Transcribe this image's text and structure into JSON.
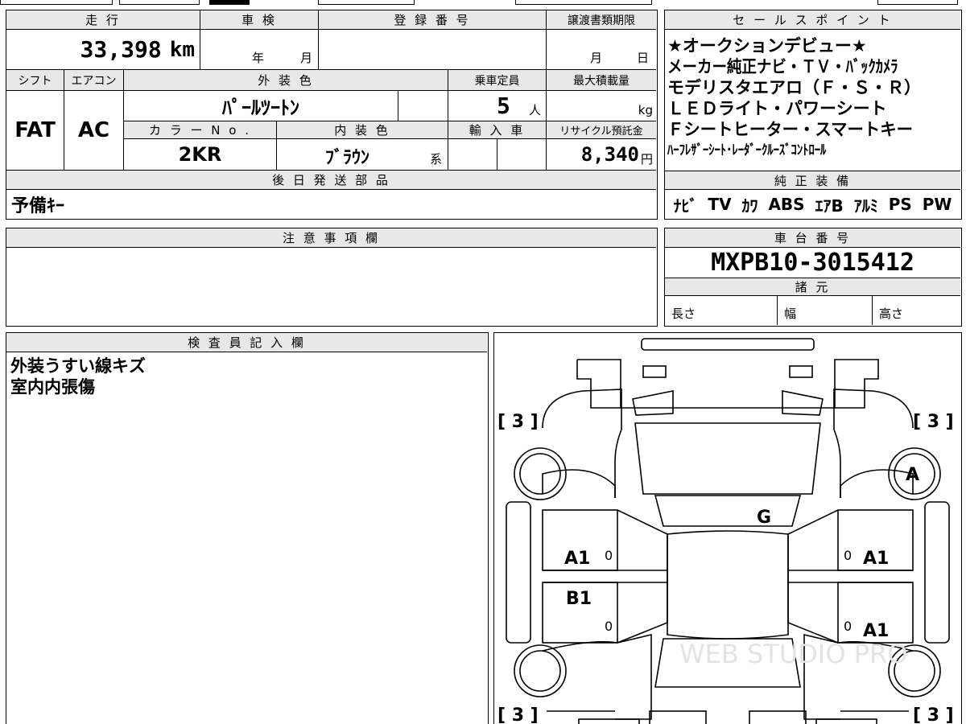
{
  "top": {
    "mileage_label": "走 行",
    "mileage_value": "33,398",
    "mileage_unit": "km",
    "shaken_label": "車 検",
    "shaken_year": "年",
    "shaken_month": "月",
    "registration_label": "登 録 番 号",
    "transfer_label": "譲渡書類期限",
    "transfer_month": "月",
    "transfer_day": "日"
  },
  "spec": {
    "shift_label": "シフト",
    "shift_value": "FAT",
    "aircon_label": "エアコン",
    "aircon_value": "AC",
    "exterior_label": "外 装 色",
    "exterior_value": "ﾊﾟｰﾙﾂｰﾄﾝ",
    "capacity_label": "乗車定員",
    "capacity_value": "5",
    "capacity_unit": "人",
    "load_label": "最大積載量",
    "load_unit": "kg",
    "color_no_label": "カ ラ ー N o .",
    "color_no_value": "2KR",
    "interior_label": "内 装 色",
    "interior_value": "ﾌﾞﾗｳﾝ",
    "interior_suffix": "系",
    "import_label": "輸 入 車",
    "recycle_label": "リサイクル預託金",
    "recycle_value": "8,340",
    "recycle_unit": "円"
  },
  "later_parts": {
    "label": "後 日 発 送 部 品",
    "value": "予備ｷｰ"
  },
  "sales_points": {
    "label": "セ ー ル ス ポ イ ン ト",
    "lines": [
      "★オークションデビュー★",
      "メーカー純正ナビ・ＴＶ・ﾊﾞｯｸｶﾒﾗ",
      "モデリスタエアロ（Ｆ・Ｓ・Ｒ）",
      "ＬＥＤライト・パワーシート",
      "Ｆシートヒーター・スマートキー",
      "ﾊｰﾌﾚｻﾞｰｼｰﾄ･ﾚｰﾀﾞｰｸﾙｰｽﾞｺﾝﾄﾛｰﾙ"
    ]
  },
  "equipment": {
    "label": "純 正 装 備",
    "items": [
      "ﾅﾋﾞ",
      "TV",
      "ｶﾜ",
      "ABS",
      "ｴｱB",
      "ｱﾙﾐ",
      "PS",
      "PW"
    ]
  },
  "notes": {
    "label": "注 意 事 項 欄",
    "value": ""
  },
  "chassis": {
    "label": "車 台 番 号",
    "value": "MXPB10-3015412"
  },
  "dimensions": {
    "label": "諸 元",
    "length_label": "長さ",
    "width_label": "幅",
    "height_label": "高さ"
  },
  "inspector": {
    "label": "検 査 員 記 入 欄",
    "lines": [
      "外装うすい線キズ",
      "室内内張傷"
    ]
  },
  "diagram": {
    "bracket_tl": "[ 3 ]",
    "bracket_tr": "[ 3 ]",
    "bracket_bl": "[ 3 ]",
    "bracket_br": "[ 3 ]",
    "mark_front_right": "A",
    "mark_windshield": "G",
    "mark_left_front_door": "A1",
    "mark_left_rear_door": "B1",
    "mark_right_front_door": "A1",
    "mark_right_rear_door": "A1",
    "zero": "0",
    "watermark": "WEB STUDIO PRO"
  }
}
